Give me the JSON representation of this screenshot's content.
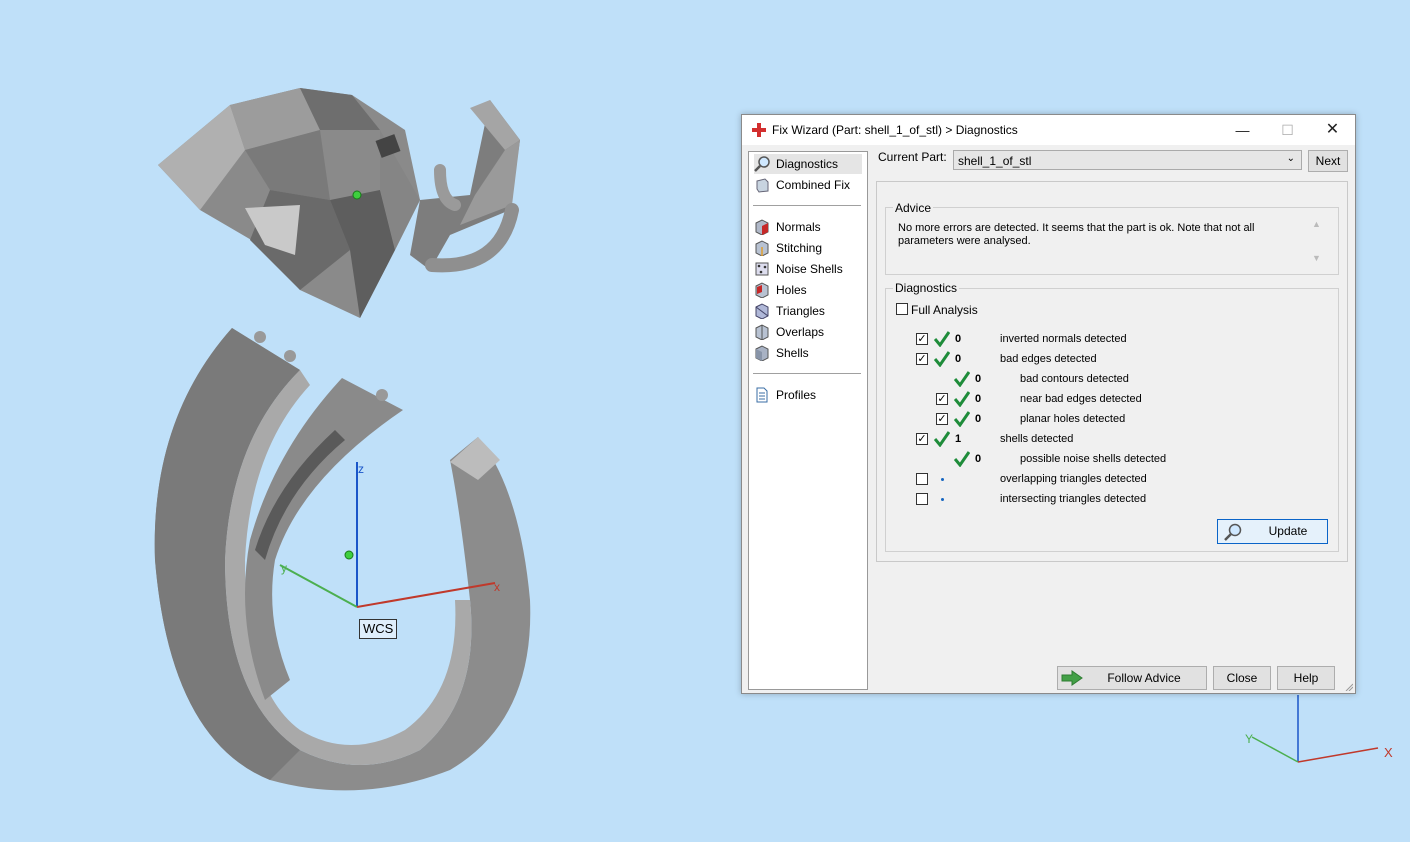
{
  "viewport": {
    "wcs_label": "WCS",
    "axis_x": "x",
    "axis_y": "y",
    "axis_z": "z",
    "mini_axis_x": "X",
    "mini_axis_y": "Y"
  },
  "dialog": {
    "title": "Fix Wizard (Part: shell_1_of_stl) > Diagnostics",
    "nav": {
      "top": [
        {
          "label": "Diagnostics",
          "icon": "magnifier-icon",
          "selected": true
        },
        {
          "label": "Combined Fix",
          "icon": "combined-fix-icon"
        }
      ],
      "tools": [
        {
          "label": "Normals",
          "icon": "normals-icon"
        },
        {
          "label": "Stitching",
          "icon": "stitching-icon"
        },
        {
          "label": "Noise Shells",
          "icon": "noise-shells-icon"
        },
        {
          "label": "Holes",
          "icon": "holes-icon"
        },
        {
          "label": "Triangles",
          "icon": "triangles-icon"
        },
        {
          "label": "Overlaps",
          "icon": "overlaps-icon"
        },
        {
          "label": "Shells",
          "icon": "shells-icon"
        }
      ],
      "bottom": [
        {
          "label": "Profiles",
          "icon": "document-icon"
        }
      ]
    },
    "current_part_label": "Current Part:",
    "current_part_value": "shell_1_of_stl",
    "next_label": "Next",
    "advice_title": "Advice",
    "advice_text": "No more errors are detected. It seems that the part is ok. Note that not all parameters were analysed.",
    "diagnostics_title": "Diagnostics",
    "full_analysis_label": "Full Analysis",
    "rows": [
      {
        "checked": true,
        "status": "ok",
        "count": "0",
        "label": "inverted normals detected",
        "indent": 0
      },
      {
        "checked": true,
        "status": "ok",
        "count": "0",
        "label": "bad edges detected",
        "indent": 0
      },
      {
        "checked": null,
        "status": "ok",
        "count": "0",
        "label": "bad contours detected",
        "indent": 1
      },
      {
        "checked": true,
        "status": "ok",
        "count": "0",
        "label": "near bad edges detected",
        "indent": 1
      },
      {
        "checked": true,
        "status": "ok",
        "count": "0",
        "label": "planar holes detected",
        "indent": 1
      },
      {
        "checked": true,
        "status": "ok",
        "count": "1",
        "label": "shells detected",
        "indent": 0
      },
      {
        "checked": null,
        "status": "ok",
        "count": "0",
        "label": "possible noise shells detected",
        "indent": 1
      },
      {
        "checked": false,
        "status": "not-analysed",
        "count": "",
        "label": "overlapping triangles detected",
        "indent": 0
      },
      {
        "checked": false,
        "status": "not-analysed",
        "count": "",
        "label": "intersecting triangles detected",
        "indent": 0
      }
    ],
    "update_label": "Update",
    "follow_advice_label": "Follow Advice",
    "close_label": "Close",
    "help_label": "Help"
  },
  "colors": {
    "background": "#bfe0f9",
    "ok_green": "#1e8c3a",
    "axis_x": "#c0392b",
    "axis_y": "#4caf50",
    "axis_z": "#1a56c9"
  }
}
